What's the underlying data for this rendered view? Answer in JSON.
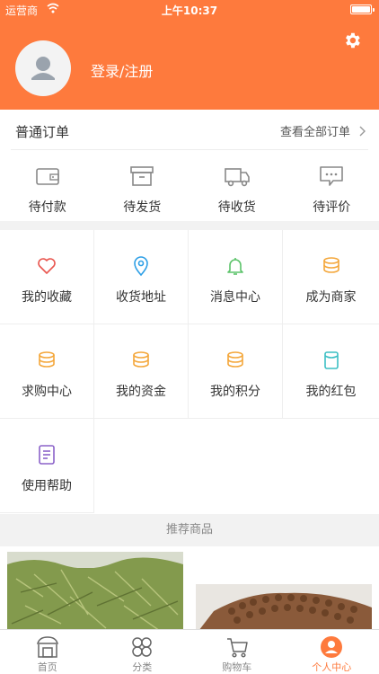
{
  "status_bar": {
    "carrier": "运营商",
    "time": "上午10:37"
  },
  "header": {
    "login_label": "登录/注册"
  },
  "orders": {
    "title": "普通订单",
    "view_all": "查看全部订单",
    "items": [
      {
        "label": "待付款",
        "icon": "wallet-icon"
      },
      {
        "label": "待发货",
        "icon": "box-icon"
      },
      {
        "label": "待收货",
        "icon": "truck-icon"
      },
      {
        "label": "待评价",
        "icon": "comment-icon"
      }
    ]
  },
  "services": [
    {
      "label": "我的收藏",
      "icon": "heart-icon",
      "color": "#e9564f"
    },
    {
      "label": "收货地址",
      "icon": "location-icon",
      "color": "#2d9fe6"
    },
    {
      "label": "消息中心",
      "icon": "bell-icon",
      "color": "#5cc36a"
    },
    {
      "label": "成为商家",
      "icon": "coins-icon",
      "color": "#f4a73b"
    },
    {
      "label": "求购中心",
      "icon": "coins-icon",
      "color": "#f4a73b"
    },
    {
      "label": "我的资金",
      "icon": "coins-icon",
      "color": "#f4a73b"
    },
    {
      "label": "我的积分",
      "icon": "coins-icon",
      "color": "#f4a73b"
    },
    {
      "label": "我的红包",
      "icon": "bag-icon",
      "color": "#3cbfc4"
    },
    {
      "label": "使用帮助",
      "icon": "document-icon",
      "color": "#8b62c9"
    }
  ],
  "recommend": {
    "title": "推荐商品"
  },
  "tabbar": [
    {
      "label": "首页",
      "icon": "home-icon",
      "active": false
    },
    {
      "label": "分类",
      "icon": "category-icon",
      "active": false
    },
    {
      "label": "购物车",
      "icon": "cart-icon",
      "active": false
    },
    {
      "label": "个人中心",
      "icon": "user-icon",
      "active": true
    }
  ],
  "colors": {
    "accent": "#fe7a3d"
  }
}
